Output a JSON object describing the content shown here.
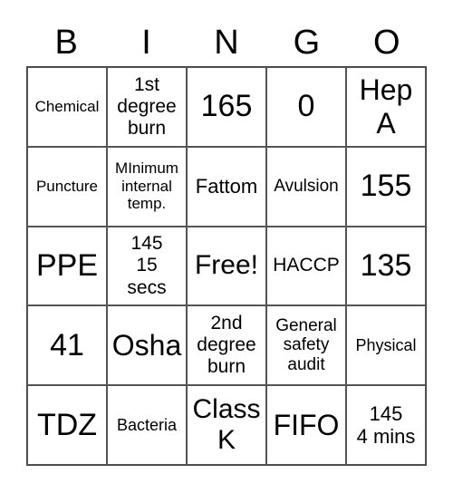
{
  "header": [
    "B",
    "I",
    "N",
    "G",
    "O"
  ],
  "cells": [
    "Chemical",
    "1st\ndegree\nburn",
    "165",
    "0",
    "Hep\nA",
    "Puncture",
    "MInimum\ninternal\ntemp.",
    "Fattom",
    "Avulsion",
    "155",
    "PPE",
    "145\n15\nsecs",
    "Free!",
    "HACCP",
    "135",
    "41",
    "Osha",
    "2nd\ndegree\nburn",
    "General\nsafety\naudit",
    "Physical",
    "TDZ",
    "Bacteria",
    "Class\nK",
    "FIFO",
    "145\n4 mins"
  ]
}
